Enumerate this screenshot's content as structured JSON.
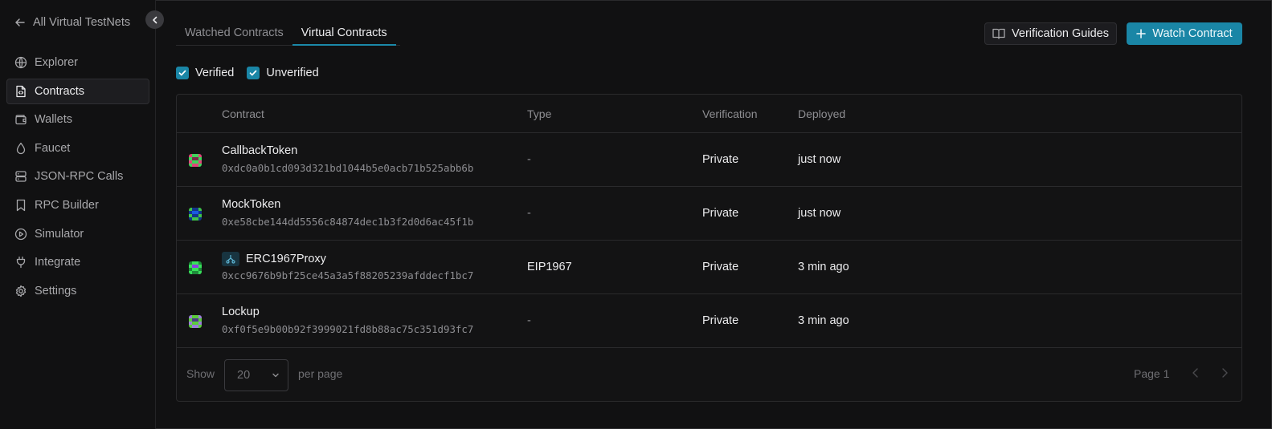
{
  "sidebar": {
    "back_label": "All Virtual TestNets",
    "items": [
      {
        "label": "Explorer",
        "icon": "globe-icon",
        "active": false
      },
      {
        "label": "Contracts",
        "icon": "file-code-icon",
        "active": true
      },
      {
        "label": "Wallets",
        "icon": "wallet-icon",
        "active": false
      },
      {
        "label": "Faucet",
        "icon": "droplet-icon",
        "active": false
      },
      {
        "label": "JSON-RPC Calls",
        "icon": "server-icon",
        "active": false
      },
      {
        "label": "RPC Builder",
        "icon": "bookmark-icon",
        "active": false
      },
      {
        "label": "Simulator",
        "icon": "play-circle-icon",
        "active": false
      },
      {
        "label": "Integrate",
        "icon": "plug-icon",
        "active": false
      },
      {
        "label": "Settings",
        "icon": "gear-icon",
        "active": false
      }
    ]
  },
  "tabs": [
    {
      "label": "Watched Contracts",
      "active": false
    },
    {
      "label": "Virtual Contracts",
      "active": true
    }
  ],
  "toolbar": {
    "guides_label": "Verification Guides",
    "watch_label": "Watch Contract"
  },
  "filters": [
    {
      "label": "Verified",
      "checked": true
    },
    {
      "label": "Unverified",
      "checked": true
    }
  ],
  "table": {
    "columns": [
      "Contract",
      "Type",
      "Verification",
      "Deployed"
    ],
    "rows": [
      {
        "name": "CallbackToken",
        "address": "0xdc0a0b1cd093d321bd1044b5e0acb71b525abb6b",
        "type": "-",
        "verification": "Private",
        "deployed": "just now",
        "proxy": false
      },
      {
        "name": "MockToken",
        "address": "0xe58cbe144dd5556c84874dec1b3f2d0d6ac45f1b",
        "type": "-",
        "verification": "Private",
        "deployed": "just now",
        "proxy": false
      },
      {
        "name": "ERC1967Proxy",
        "address": "0xcc9676b9bf25ce45a3a5f88205239afddecf1bc7",
        "type": "EIP1967",
        "verification": "Private",
        "deployed": "3 min ago",
        "proxy": true
      },
      {
        "name": "Lockup",
        "address": "0xf0f5e9b00b92f3999021fd8b88ac75c351d93fc7",
        "type": "-",
        "verification": "Private",
        "deployed": "3 min ago",
        "proxy": false
      }
    ]
  },
  "pagination": {
    "show_label": "Show",
    "per_page_value": "20",
    "per_page_label": "per page",
    "page_label": "Page 1"
  },
  "colors": {
    "accent": "#1a86a6",
    "background": "#111112"
  }
}
